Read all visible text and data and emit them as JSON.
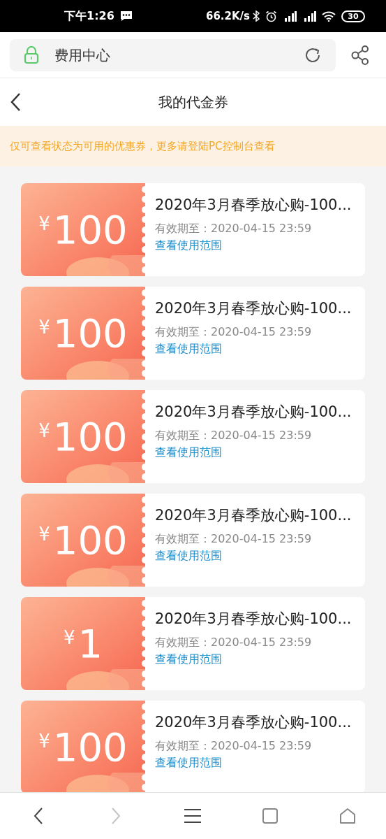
{
  "status_bar": {
    "time": "下午1:26",
    "speed": "66.2K/s",
    "battery": "30"
  },
  "address_bar": {
    "title": "费用中心"
  },
  "header": {
    "title": "我的代金券"
  },
  "notice": "仅可查看状态为可用的优惠券，更多请登陆PC控制台查看",
  "coupons": [
    {
      "currency": "¥",
      "amount": "100",
      "title": "2020年3月春季放心购-100...",
      "expiry": "有效期至：2020-04-15 23:59",
      "link": "查看使用范围"
    },
    {
      "currency": "¥",
      "amount": "100",
      "title": "2020年3月春季放心购-100...",
      "expiry": "有效期至：2020-04-15 23:59",
      "link": "查看使用范围"
    },
    {
      "currency": "¥",
      "amount": "100",
      "title": "2020年3月春季放心购-100...",
      "expiry": "有效期至：2020-04-15 23:59",
      "link": "查看使用范围"
    },
    {
      "currency": "¥",
      "amount": "100",
      "title": "2020年3月春季放心购-100...",
      "expiry": "有效期至：2020-04-15 23:59",
      "link": "查看使用范围"
    },
    {
      "currency": "¥",
      "amount": "1",
      "title": "2020年3月春季放心购-100...",
      "expiry": "有效期至：2020-04-15 23:59",
      "link": "查看使用范围"
    },
    {
      "currency": "¥",
      "amount": "100",
      "title": "2020年3月春季放心购-100...",
      "expiry": "有效期至：2020-04-15 23:59",
      "link": "查看使用范围"
    }
  ],
  "bottom_nav": {
    "back_disabled": false,
    "forward_disabled": true
  }
}
